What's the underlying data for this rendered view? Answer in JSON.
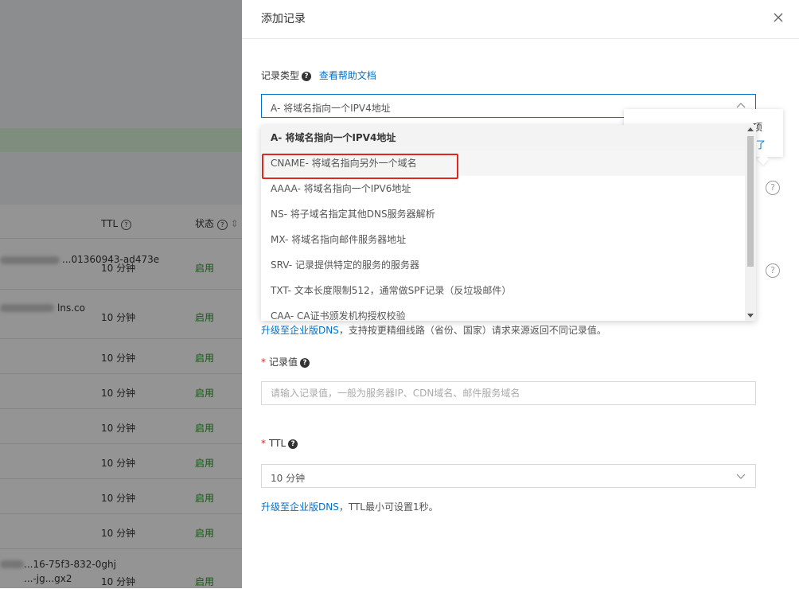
{
  "background": {
    "columns": {
      "ttl": "TTL",
      "status": "状态"
    },
    "rows": [
      {
        "host": "...01360943-ad473e",
        "ttl": "10 分钟",
        "status": "启用"
      },
      {
        "host": "lns.co",
        "ttl": "10 分钟",
        "status": "启用"
      },
      {
        "host": "",
        "ttl": "10 分钟",
        "status": "启用"
      },
      {
        "host": "",
        "ttl": "10 分钟",
        "status": "启用"
      },
      {
        "host": "",
        "ttl": "10 分钟",
        "status": "启用"
      },
      {
        "host": "",
        "ttl": "10 分钟",
        "status": "启用"
      },
      {
        "host": "",
        "ttl": "10 分钟",
        "status": "启用"
      },
      {
        "host": "",
        "ttl": "10 分钟",
        "status": "启用"
      },
      {
        "host": "...16-75f3-832-0ghj",
        "ttl": "10 分钟",
        "status": "启用"
      }
    ],
    "row_host_last2": "...-jg...gx2"
  },
  "drawer": {
    "title": "添加记录",
    "record_type": {
      "label": "记录类型",
      "help_link": "查看帮助文档",
      "selected": "A- 将域名指向一个IPV4地址",
      "options": [
        "A- 将域名指向一个IPV4地址",
        "CNAME- 将域名指向另外一个域名",
        "AAAA- 将域名指向一个IPV6地址",
        "NS- 将子域名指定其他DNS服务器解析",
        "MX- 将域名指向邮件服务器地址",
        "SRV- 记录提供特定的服务的服务器",
        "TXT- 文本长度限制512，通常做SPF记录（反垃圾邮件）",
        "CAA- CA证书颁发机构授权校验"
      ],
      "highlighted_option_index": 1
    },
    "popover": {
      "line1": "项",
      "line2": "了"
    },
    "line_hint": {
      "link": "升级至企业版DNS",
      "text": "，支持按更精细线路（省份、国家）请求来源返回不同记录值。"
    },
    "record_value": {
      "label": "记录值",
      "placeholder": "请输入记录值，一般为服务器IP、CDN域名、邮件服务域名"
    },
    "ttl": {
      "label": "TTL",
      "value": "10 分钟",
      "hint_link": "升级至企业版DNS",
      "hint_text": "，TTL最小可设置1秒。"
    }
  },
  "colors": {
    "accent": "#0070cc",
    "highlight": "#e0261f",
    "status_green": "#1f9a1f"
  },
  "icons": {
    "close": "close-icon",
    "help": "help-icon",
    "chevron": "chevron-down-icon"
  }
}
